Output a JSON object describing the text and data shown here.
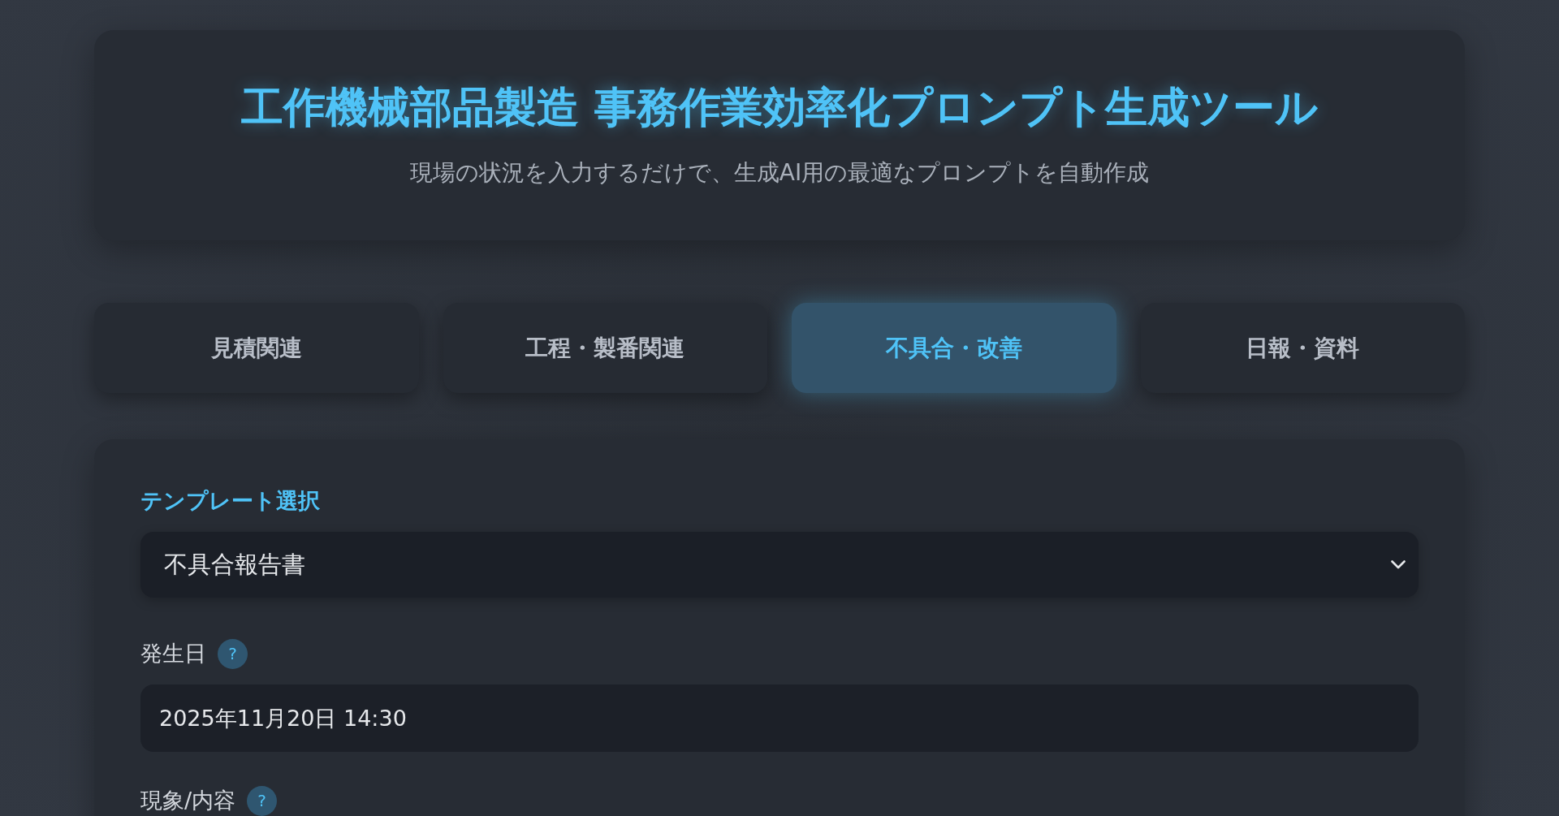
{
  "header": {
    "title": "工作機械部品製造 事務作業効率化プロンプト生成ツール",
    "subtitle": "現場の状況を入力するだけで、生成AI用の最適なプロンプトを自動作成"
  },
  "tabs": [
    {
      "label": "見積関連",
      "selected": false
    },
    {
      "label": "工程・製番関連",
      "selected": false
    },
    {
      "label": "不具合・改善",
      "selected": true
    },
    {
      "label": "日報・資料",
      "selected": false
    }
  ],
  "form": {
    "template": {
      "label": "テンプレート選択",
      "value": "不具合報告書"
    },
    "fields": [
      {
        "kind": "input",
        "label": "発生日",
        "help": "?",
        "value": "2025年11月20日 14:30"
      },
      {
        "kind": "textarea",
        "label": "現象/内容",
        "help": "?"
      }
    ]
  }
}
